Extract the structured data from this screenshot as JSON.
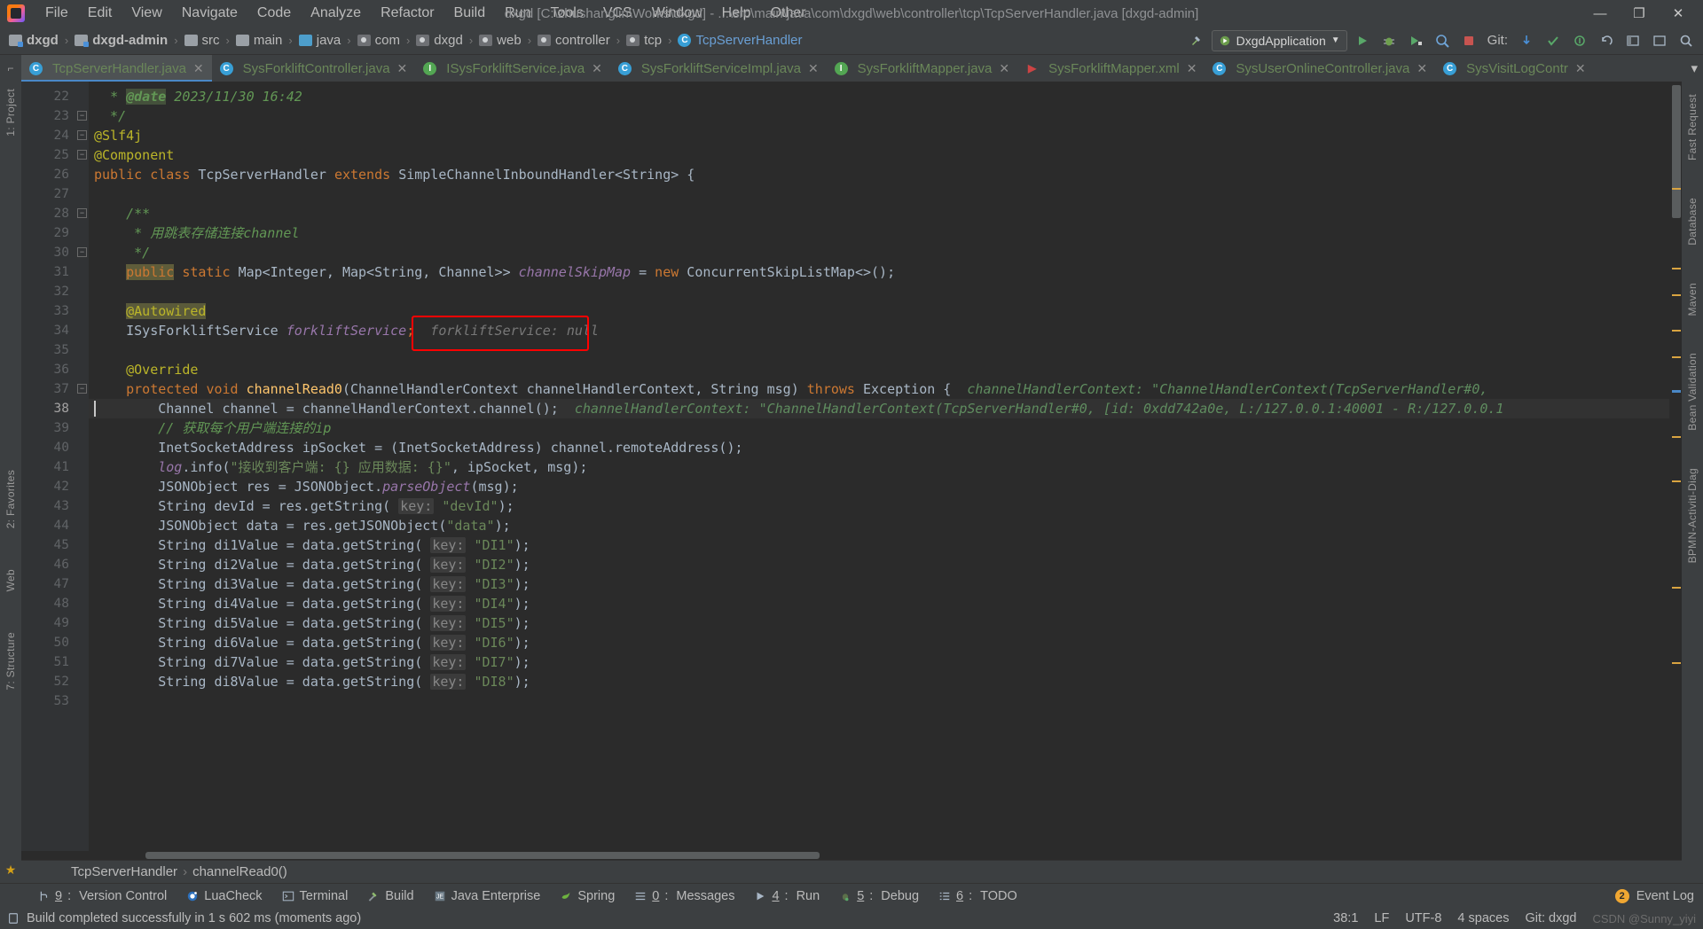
{
  "window": {
    "title": "dxgd [C:\\zhushanglin\\Works\\dxgd] - ...\\src\\main\\java\\com\\dxgd\\web\\controller\\tcp\\TcpServerHandler.java [dxgd-admin]",
    "minimize": "—",
    "maximize": "❐",
    "close": "✕"
  },
  "menu": {
    "items": [
      "File",
      "Edit",
      "View",
      "Navigate",
      "Code",
      "Analyze",
      "Refactor",
      "Build",
      "Run",
      "Tools",
      "VCS",
      "Window",
      "Help",
      "Other"
    ]
  },
  "navbar": {
    "crumbs": [
      {
        "label": "dxgd",
        "icon": "module-icon",
        "bold": true
      },
      {
        "label": "dxgd-admin",
        "icon": "module-icon",
        "bold": true
      },
      {
        "label": "src",
        "icon": "folder-icon",
        "bold": false
      },
      {
        "label": "main",
        "icon": "folder-icon",
        "bold": false
      },
      {
        "label": "java",
        "icon": "source-folder-icon",
        "bold": false
      },
      {
        "label": "com",
        "icon": "package-icon",
        "bold": false
      },
      {
        "label": "dxgd",
        "icon": "package-icon",
        "bold": false
      },
      {
        "label": "web",
        "icon": "package-icon",
        "bold": false
      },
      {
        "label": "controller",
        "icon": "package-icon",
        "bold": false
      },
      {
        "label": "tcp",
        "icon": "package-icon",
        "bold": false
      },
      {
        "label": "TcpServerHandler",
        "icon": "class-icon",
        "bold": false
      }
    ],
    "run_config": "DxgdApplication",
    "git_label": "Git:"
  },
  "tabs": [
    {
      "label": "TcpServerHandler.java",
      "icon": "java-class-icon",
      "active": true
    },
    {
      "label": "SysForkliftController.java",
      "icon": "java-class-icon",
      "active": false
    },
    {
      "label": "ISysForkliftService.java",
      "icon": "java-interface-icon",
      "active": false
    },
    {
      "label": "SysForkliftServiceImpl.java",
      "icon": "java-class-icon",
      "active": false
    },
    {
      "label": "SysForkliftMapper.java",
      "icon": "java-interface-icon",
      "active": false
    },
    {
      "label": "SysForkliftMapper.xml",
      "icon": "mybatis-xml-icon",
      "active": false
    },
    {
      "label": "SysUserOnlineController.java",
      "icon": "java-class-icon",
      "active": false
    },
    {
      "label": "SysVisitLogContr",
      "icon": "java-class-icon",
      "active": false
    }
  ],
  "left_strip": [
    "1: Project",
    "2: Favorites",
    "Web",
    "7: Structure"
  ],
  "right_strip": [
    "Fast Request",
    "Database",
    "Maven",
    "Bean Validation",
    "BPMN-Activiti-Diag"
  ],
  "editor": {
    "first_line": 22,
    "lines": [
      {
        "n": 22,
        "fold": "",
        "tokens": [
          {
            "t": "  ",
            "c": "txt"
          },
          {
            "t": "* ",
            "c": "cmt"
          },
          {
            "t": "@date",
            "c": "cmt-tag"
          },
          {
            "t": " 2023/11/30 16:42",
            "c": "cmt"
          }
        ]
      },
      {
        "n": 23,
        "fold": "end",
        "tokens": [
          {
            "t": "  */",
            "c": "cmt"
          }
        ]
      },
      {
        "n": 24,
        "fold": "start",
        "tokens": [
          {
            "t": "@Slf4j",
            "c": "anno"
          }
        ]
      },
      {
        "n": 25,
        "fold": "start",
        "tokens": [
          {
            "t": "@Component",
            "c": "anno"
          }
        ]
      },
      {
        "n": 26,
        "fold": "",
        "tokens": [
          {
            "t": "public ",
            "c": "kw"
          },
          {
            "t": "class ",
            "c": "kw"
          },
          {
            "t": "TcpServerHandler ",
            "c": "typ"
          },
          {
            "t": "extends ",
            "c": "kw"
          },
          {
            "t": "SimpleChannelInboundHandler<String> {",
            "c": "typ"
          }
        ]
      },
      {
        "n": 27,
        "fold": "",
        "tokens": []
      },
      {
        "n": 28,
        "fold": "start",
        "tokens": [
          {
            "t": "    /**",
            "c": "cmt"
          }
        ]
      },
      {
        "n": 29,
        "fold": "",
        "tokens": [
          {
            "t": "     * 用跳表存储连接channel",
            "c": "cmt"
          }
        ]
      },
      {
        "n": 30,
        "fold": "end",
        "tokens": [
          {
            "t": "     */",
            "c": "cmt"
          }
        ]
      },
      {
        "n": 31,
        "fold": "",
        "tokens": [
          {
            "t": "    ",
            "c": "txt"
          },
          {
            "t": "public",
            "c": "kwhl"
          },
          {
            "t": " ",
            "c": "txt"
          },
          {
            "t": "static ",
            "c": "kw"
          },
          {
            "t": "Map<Integer, Map<String, Channel>> ",
            "c": "typ"
          },
          {
            "t": "channelSkipMap",
            "c": "stfld"
          },
          {
            "t": " = ",
            "c": "txt"
          },
          {
            "t": "new ",
            "c": "kw"
          },
          {
            "t": "ConcurrentSkipListMap<>();",
            "c": "typ"
          }
        ]
      },
      {
        "n": 32,
        "fold": "",
        "tokens": []
      },
      {
        "n": 33,
        "fold": "",
        "tokens": [
          {
            "t": "    ",
            "c": "txt"
          },
          {
            "t": "@Autowired",
            "c": "anno hl"
          }
        ]
      },
      {
        "n": 34,
        "fold": "",
        "tokens": [
          {
            "t": "    ",
            "c": "txt"
          },
          {
            "t": "ISysForkliftService ",
            "c": "typ"
          },
          {
            "t": "forkliftService",
            "c": "fld"
          },
          {
            "t": ";",
            "c": "kw"
          },
          {
            "t": "  forkliftService: null",
            "c": "hint"
          }
        ]
      },
      {
        "n": 35,
        "fold": "",
        "tokens": []
      },
      {
        "n": 36,
        "fold": "",
        "tokens": [
          {
            "t": "    ",
            "c": "txt"
          },
          {
            "t": "@Override",
            "c": "anno"
          }
        ]
      },
      {
        "n": 37,
        "fold": "start",
        "tokens": [
          {
            "t": "    ",
            "c": "txt"
          },
          {
            "t": "protected ",
            "c": "kw"
          },
          {
            "t": "void ",
            "c": "kw"
          },
          {
            "t": "channelRead0",
            "c": "mth"
          },
          {
            "t": "(ChannelHandlerContext channelHandlerContext, String msg) ",
            "c": "typ"
          },
          {
            "t": "throws ",
            "c": "kw"
          },
          {
            "t": "Exception {",
            "c": "typ"
          },
          {
            "t": "  channelHandlerContext: \"ChannelHandlerContext(TcpServerHandler#0,",
            "c": "dbghint"
          }
        ]
      },
      {
        "n": 38,
        "fold": "",
        "current": true,
        "tokens": [
          {
            "t": "        ",
            "c": "txt"
          },
          {
            "t": "Channel ",
            "c": "typ"
          },
          {
            "t": "channel",
            "c": "txt"
          },
          {
            "t": " = channelHandlerContext.",
            "c": "txt"
          },
          {
            "t": "channel",
            "c": "txt"
          },
          {
            "t": "();",
            "c": "txt"
          },
          {
            "t": "  channelHandlerContext: \"ChannelHandlerContext(TcpServerHandler#0, [id: 0xdd742a0e, L:/127.0.0.1:40001 - R:/127.0.0.1",
            "c": "dbghint"
          }
        ]
      },
      {
        "n": 39,
        "fold": "",
        "tokens": [
          {
            "t": "        // 获取每个用户端连接的ip",
            "c": "cmt"
          }
        ]
      },
      {
        "n": 40,
        "fold": "",
        "tokens": [
          {
            "t": "        ",
            "c": "txt"
          },
          {
            "t": "InetSocketAddress ",
            "c": "typ"
          },
          {
            "t": "ipSocket = (InetSocketAddress) channel.remoteAddress();",
            "c": "txt"
          }
        ]
      },
      {
        "n": 41,
        "fold": "",
        "tokens": [
          {
            "t": "        ",
            "c": "txt"
          },
          {
            "t": "log",
            "c": "stfld"
          },
          {
            "t": ".info(",
            "c": "txt"
          },
          {
            "t": "\"接收到客户端: {} 应用数据: {}\"",
            "c": "str"
          },
          {
            "t": ", ipSocket, msg);",
            "c": "txt"
          }
        ]
      },
      {
        "n": 42,
        "fold": "",
        "tokens": [
          {
            "t": "        ",
            "c": "txt"
          },
          {
            "t": "JSONObject ",
            "c": "typ"
          },
          {
            "t": "res = JSONObject.",
            "c": "txt"
          },
          {
            "t": "parseObject",
            "c": "stfld"
          },
          {
            "t": "(msg);",
            "c": "txt"
          }
        ]
      },
      {
        "n": 43,
        "fold": "",
        "tokens": [
          {
            "t": "        ",
            "c": "txt"
          },
          {
            "t": "String ",
            "c": "typ"
          },
          {
            "t": "devId = res.getString( ",
            "c": "txt"
          },
          {
            "t": "key:",
            "c": "hintbg"
          },
          {
            "t": " ",
            "c": "txt"
          },
          {
            "t": "\"devId\"",
            "c": "str"
          },
          {
            "t": ");",
            "c": "txt"
          }
        ]
      },
      {
        "n": 44,
        "fold": "",
        "tokens": [
          {
            "t": "        ",
            "c": "txt"
          },
          {
            "t": "JSONObject ",
            "c": "typ"
          },
          {
            "t": "data = res.getJSONObject(",
            "c": "txt"
          },
          {
            "t": "\"data\"",
            "c": "str"
          },
          {
            "t": ");",
            "c": "txt"
          }
        ]
      },
      {
        "n": 45,
        "fold": "",
        "tokens": [
          {
            "t": "        ",
            "c": "txt"
          },
          {
            "t": "String ",
            "c": "typ"
          },
          {
            "t": "di1Value = data.getString( ",
            "c": "txt"
          },
          {
            "t": "key:",
            "c": "hintbg"
          },
          {
            "t": " ",
            "c": "txt"
          },
          {
            "t": "\"DI1\"",
            "c": "str"
          },
          {
            "t": ");",
            "c": "txt"
          }
        ]
      },
      {
        "n": 46,
        "fold": "",
        "tokens": [
          {
            "t": "        ",
            "c": "txt"
          },
          {
            "t": "String ",
            "c": "typ"
          },
          {
            "t": "di2Value = data.getString( ",
            "c": "txt"
          },
          {
            "t": "key:",
            "c": "hintbg"
          },
          {
            "t": " ",
            "c": "txt"
          },
          {
            "t": "\"DI2\"",
            "c": "str"
          },
          {
            "t": ");",
            "c": "txt"
          }
        ]
      },
      {
        "n": 47,
        "fold": "",
        "tokens": [
          {
            "t": "        ",
            "c": "txt"
          },
          {
            "t": "String ",
            "c": "typ"
          },
          {
            "t": "di3Value = data.getString( ",
            "c": "txt"
          },
          {
            "t": "key:",
            "c": "hintbg"
          },
          {
            "t": " ",
            "c": "txt"
          },
          {
            "t": "\"DI3\"",
            "c": "str"
          },
          {
            "t": ");",
            "c": "txt"
          }
        ]
      },
      {
        "n": 48,
        "fold": "",
        "tokens": [
          {
            "t": "        ",
            "c": "txt"
          },
          {
            "t": "String ",
            "c": "typ"
          },
          {
            "t": "di4Value = data.getString( ",
            "c": "txt"
          },
          {
            "t": "key:",
            "c": "hintbg"
          },
          {
            "t": " ",
            "c": "txt"
          },
          {
            "t": "\"DI4\"",
            "c": "str"
          },
          {
            "t": ");",
            "c": "txt"
          }
        ]
      },
      {
        "n": 49,
        "fold": "",
        "tokens": [
          {
            "t": "        ",
            "c": "txt"
          },
          {
            "t": "String ",
            "c": "typ"
          },
          {
            "t": "di5Value = data.getString( ",
            "c": "txt"
          },
          {
            "t": "key:",
            "c": "hintbg"
          },
          {
            "t": " ",
            "c": "txt"
          },
          {
            "t": "\"DI5\"",
            "c": "str"
          },
          {
            "t": ");",
            "c": "txt"
          }
        ]
      },
      {
        "n": 50,
        "fold": "",
        "tokens": [
          {
            "t": "        ",
            "c": "txt"
          },
          {
            "t": "String ",
            "c": "typ"
          },
          {
            "t": "di6Value = data.getString( ",
            "c": "txt"
          },
          {
            "t": "key:",
            "c": "hintbg"
          },
          {
            "t": " ",
            "c": "txt"
          },
          {
            "t": "\"DI6\"",
            "c": "str"
          },
          {
            "t": ");",
            "c": "txt"
          }
        ]
      },
      {
        "n": 51,
        "fold": "",
        "tokens": [
          {
            "t": "        ",
            "c": "txt"
          },
          {
            "t": "String ",
            "c": "typ"
          },
          {
            "t": "di7Value = data.getString( ",
            "c": "txt"
          },
          {
            "t": "key:",
            "c": "hintbg"
          },
          {
            "t": " ",
            "c": "txt"
          },
          {
            "t": "\"DI7\"",
            "c": "str"
          },
          {
            "t": ");",
            "c": "txt"
          }
        ]
      },
      {
        "n": 52,
        "fold": "",
        "tokens": [
          {
            "t": "        ",
            "c": "txt"
          },
          {
            "t": "String ",
            "c": "typ"
          },
          {
            "t": "di8Value = data.getString( ",
            "c": "txt"
          },
          {
            "t": "key:",
            "c": "hintbg"
          },
          {
            "t": " ",
            "c": "txt"
          },
          {
            "t": "\"DI8\"",
            "c": "str"
          },
          {
            "t": ");",
            "c": "txt"
          }
        ]
      },
      {
        "n": 53,
        "fold": "",
        "tokens": []
      }
    ],
    "annotation_box": {
      "color": "#ff0000",
      "label": "forkliftService: null"
    }
  },
  "breadcrumb": {
    "class": "TcpServerHandler",
    "sep": "›",
    "method": "channelRead0()"
  },
  "bottom_tools": [
    {
      "num": "9",
      "label": "Version Control",
      "icon": "version-control-icon"
    },
    {
      "num": "",
      "label": "LuaCheck",
      "icon": "luacheck-icon"
    },
    {
      "num": "",
      "label": "Terminal",
      "icon": "terminal-icon"
    },
    {
      "num": "",
      "label": "Build",
      "icon": "build-icon"
    },
    {
      "num": "",
      "label": "Java Enterprise",
      "icon": "java-enterprise-icon"
    },
    {
      "num": "",
      "label": "Spring",
      "icon": "spring-icon"
    },
    {
      "num": "0",
      "label": "Messages",
      "icon": "messages-icon"
    },
    {
      "num": "4",
      "label": "Run",
      "icon": "run-icon"
    },
    {
      "num": "5",
      "label": "Debug",
      "icon": "debug-icon"
    },
    {
      "num": "6",
      "label": "TODO",
      "icon": "todo-icon"
    }
  ],
  "event_log": {
    "label": "Event Log",
    "count": "2"
  },
  "statusbar": {
    "message": "Build completed successfully in 1 s 602 ms (moments ago)",
    "caret": "38:1",
    "line_sep": "LF",
    "encoding": "UTF-8",
    "indent": "4 spaces",
    "git_branch": "Git: dxgd",
    "watermark": "CSDN @Sunny_yiyi"
  }
}
